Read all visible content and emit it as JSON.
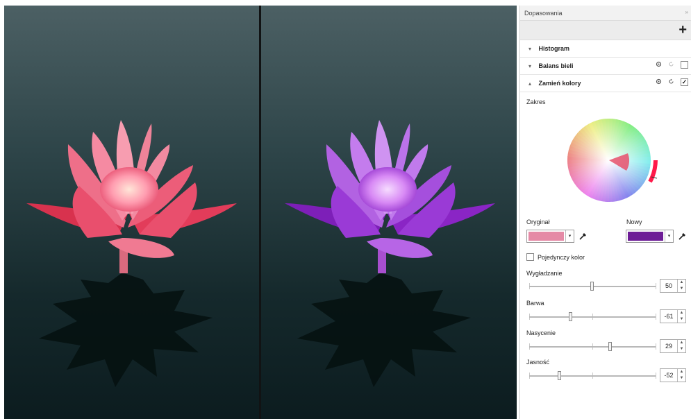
{
  "panel": {
    "title": "Dopasowania",
    "collapse_glyph": "»",
    "add_glyph": "+"
  },
  "sections": [
    {
      "label": "Histogram",
      "arrow": "▾"
    },
    {
      "label": "Balans bieli",
      "arrow": "▾",
      "enabled": false
    },
    {
      "label": "Zamień kolory",
      "arrow": "▴",
      "enabled": true
    }
  ],
  "icons": {
    "view": "eye-icon",
    "reset": "reset-icon",
    "check_mark": "✓"
  },
  "range_label": "Zakres",
  "original": {
    "label": "Oryginał",
    "color": "#e58aa6"
  },
  "new": {
    "label": "Nowy",
    "color": "#6d1c96"
  },
  "single_color_label": "Pojedynczy kolor",
  "sliders": [
    {
      "label": "Wygładzanie",
      "value": "50",
      "fraction": 0.5
    },
    {
      "label": "Barwa",
      "value": "-61",
      "fraction": 0.33
    },
    {
      "label": "Nasycenie",
      "value": "29",
      "fraction": 0.645
    },
    {
      "label": "Jasność",
      "value": "-52",
      "fraction": 0.24
    }
  ],
  "colors": {
    "water_dark": "#0f2225",
    "water_light": "#44595d",
    "lotus_pink": "#ea5873",
    "lotus_purple": "#9c36d6"
  }
}
